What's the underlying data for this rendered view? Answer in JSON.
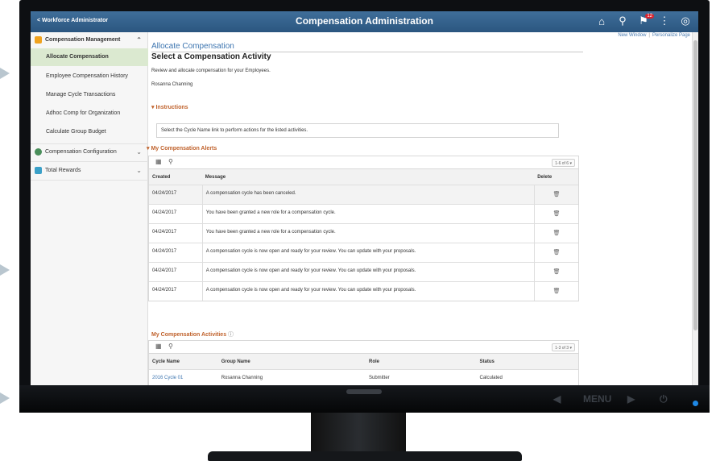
{
  "header": {
    "back_label": "< Workforce Administrator",
    "title": "Compensation Administration",
    "icons": [
      "home-icon",
      "search-icon",
      "notification-flag-icon",
      "more-actions-icon",
      "navbar-compass-icon"
    ],
    "notification_count": "12"
  },
  "top_links": {
    "new_window": "New Window",
    "personalize": "Personalize Page"
  },
  "leftnav": {
    "groups": [
      {
        "label": "Compensation Management",
        "icon": "folder-icon",
        "color": "#f0a21e",
        "expanded": true,
        "items": [
          {
            "label": "Allocate Compensation",
            "active": true
          },
          {
            "label": "Employee Compensation History",
            "active": false
          },
          {
            "label": "Manage Cycle Transactions",
            "active": false
          },
          {
            "label": "Adhoc Comp for Organization",
            "active": false
          },
          {
            "label": "Calculate Group Budget",
            "active": false
          }
        ]
      },
      {
        "label": "Compensation Configuration",
        "icon": "people-icon",
        "color": "#4a8f5b",
        "expanded": false,
        "items": []
      },
      {
        "label": "Total Rewards",
        "icon": "rewards-icon",
        "color": "#3aa0c8",
        "expanded": false,
        "items": []
      }
    ]
  },
  "page": {
    "breadcrumb": "Allocate Compensation",
    "title": "Select a Compensation Activity",
    "description": "Review and allocate compensation for your Employees.",
    "user_name": "Rosanna Channing",
    "instructions_heading": "Instructions",
    "instructions_text": "Select the Cycle Name link to perform actions for the listed activities."
  },
  "alerts": {
    "heading": "My Compensation Alerts",
    "pager": "1-6 of 6",
    "columns": [
      "Created",
      "Message",
      "Delete"
    ],
    "rows": [
      {
        "created": "04/24/2017",
        "message": "A compensation cycle has been canceled."
      },
      {
        "created": "04/24/2017",
        "message": "You have been granted a new role for a compensation cycle."
      },
      {
        "created": "04/24/2017",
        "message": "You have been granted a new role for a compensation cycle."
      },
      {
        "created": "04/24/2017",
        "message": "A compensation cycle is now open and ready for your review. You can update with your proposals."
      },
      {
        "created": "04/24/2017",
        "message": "A compensation cycle is now open and ready for your review. You can update with your proposals."
      },
      {
        "created": "04/24/2017",
        "message": "A compensation cycle is now open and ready for your review. You can update with your proposals."
      }
    ]
  },
  "activities": {
    "heading": "My Compensation Activities",
    "pager": "1-3 of 3",
    "columns": [
      "Cycle Name",
      "Group Name",
      "Role",
      "Status"
    ],
    "rows": [
      {
        "cycle": "2016 Cycle 01",
        "group": "Rosanna Channing",
        "role": "Submitter",
        "status": "Calculated"
      }
    ]
  },
  "hardware": {
    "menu_label": "MENU"
  }
}
